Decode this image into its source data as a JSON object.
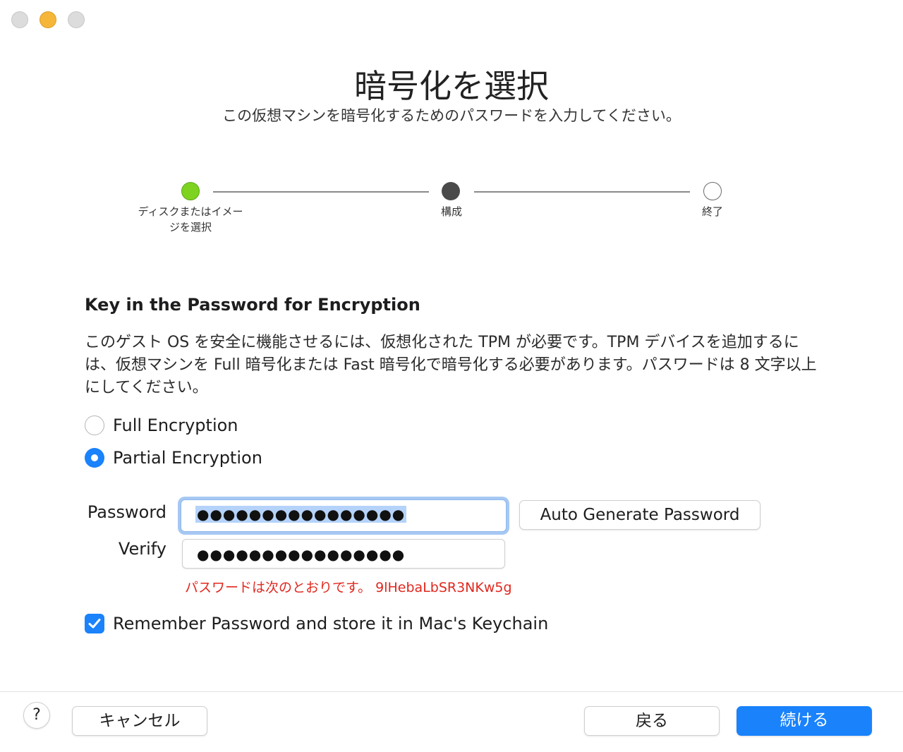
{
  "window": {
    "controls": [
      "close-button",
      "minimize-button",
      "zoom-button"
    ]
  },
  "header": {
    "title": "暗号化を選択",
    "subtitle": "この仮想マシンを暗号化するためのパスワードを入力してください。"
  },
  "stepper": {
    "steps": [
      {
        "label": "ディスクまたはイメージを選択",
        "state": "done"
      },
      {
        "label": "構成",
        "state": "current"
      },
      {
        "label": "終了",
        "state": "todo"
      }
    ]
  },
  "main": {
    "section_title": "Key in the Password for Encryption",
    "description": "このゲスト OS を安全に機能させるには、仮想化された TPM が必要です。TPM デバイスを追加するには、仮想マシンを Full 暗号化または Fast 暗号化で暗号化する必要があります。パスワードは 8 文字以上にしてください。",
    "options": [
      {
        "label": "Full Encryption",
        "selected": false
      },
      {
        "label": "Partial Encryption",
        "selected": true
      }
    ],
    "password_label": "Password",
    "password_value": "●●●●●●●●●●●●●●●●",
    "verify_label": "Verify",
    "verify_value": "●●●●●●●●●●●●●●●●",
    "auto_generate_label": "Auto Generate Password",
    "generated_message": "パスワードは次のとおりです。 9lHebaLbSR3NKw5g",
    "remember_label": "Remember Password and store it in Mac's Keychain",
    "remember_checked": true
  },
  "footer": {
    "help_label": "?",
    "cancel_label": "キャンセル",
    "back_label": "戻る",
    "continue_label": "続ける"
  },
  "colors": {
    "accent": "#1a82fb",
    "step_done": "#7ed321",
    "error_text": "#e0281f"
  }
}
